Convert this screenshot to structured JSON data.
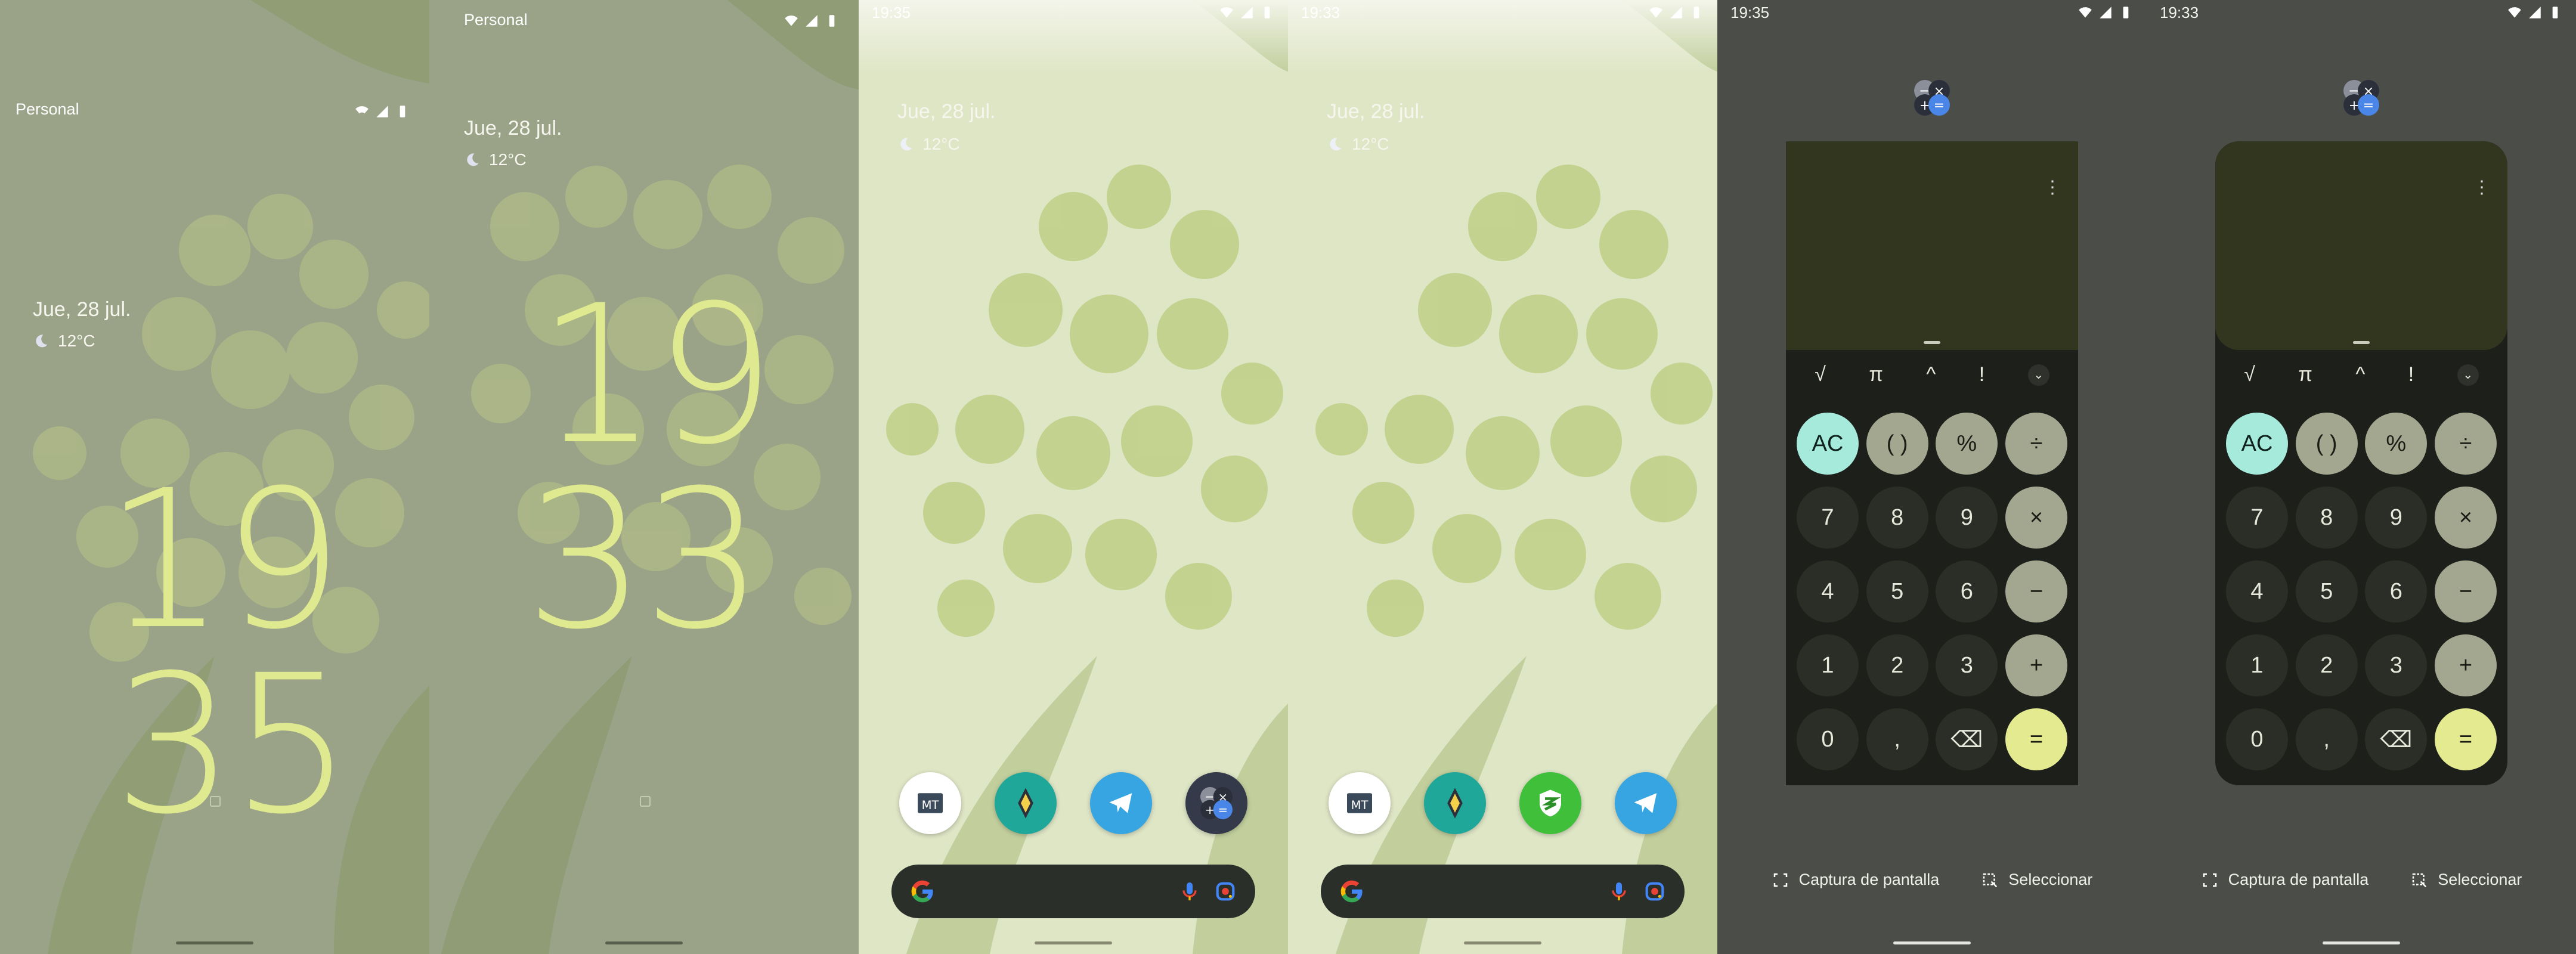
{
  "lock_personal_1": {
    "profile_label": "Personal",
    "date": "Jue, 28 jul.",
    "temperature": "12°C",
    "clock_hours": "19",
    "clock_minutes": "35"
  },
  "lock_personal_2": {
    "profile_label": "Personal",
    "date": "Jue, 28 jul.",
    "temperature": "12°C",
    "clock_hours": "19",
    "clock_minutes": "33"
  },
  "home_1": {
    "status_time": "19:35",
    "date": "Jue, 28 jul.",
    "temperature": "12°C",
    "dock_apps": [
      "mt-manager",
      "magisk",
      "telegram",
      "calculator"
    ]
  },
  "home_2": {
    "status_time": "19:33",
    "date": "Jue, 28 jul.",
    "temperature": "12°C",
    "dock_apps": [
      "mt-manager",
      "magisk",
      "app-3-green",
      "telegram"
    ]
  },
  "recents_1": {
    "status_time": "19:35",
    "sci_keys": [
      "√",
      "π",
      "^",
      "!"
    ],
    "keys": [
      "AC",
      "( )",
      "%",
      "÷",
      "7",
      "8",
      "9",
      "×",
      "4",
      "5",
      "6",
      "−",
      "1",
      "2",
      "3",
      "+",
      "0",
      ",",
      "⌫",
      "="
    ],
    "action_screenshot": "Captura de pantalla",
    "action_select": "Seleccionar"
  },
  "recents_2": {
    "status_time": "19:33",
    "sci_keys": [
      "√",
      "π",
      "^",
      "!"
    ],
    "keys": [
      "AC",
      "( )",
      "%",
      "÷",
      "7",
      "8",
      "9",
      "×",
      "4",
      "5",
      "6",
      "−",
      "1",
      "2",
      "3",
      "+",
      "0",
      ",",
      "⌫",
      "="
    ],
    "action_screenshot": "Captura de pantalla",
    "action_select": "Seleccionar"
  },
  "colors": {
    "clock": "#dfe98f",
    "wall_light": "#dfe7c8",
    "wall_dim": "#9da78c",
    "calc_ac": "#a5eadb",
    "calc_eq": "#e3ea90",
    "calc_op": "#a3a78f"
  }
}
